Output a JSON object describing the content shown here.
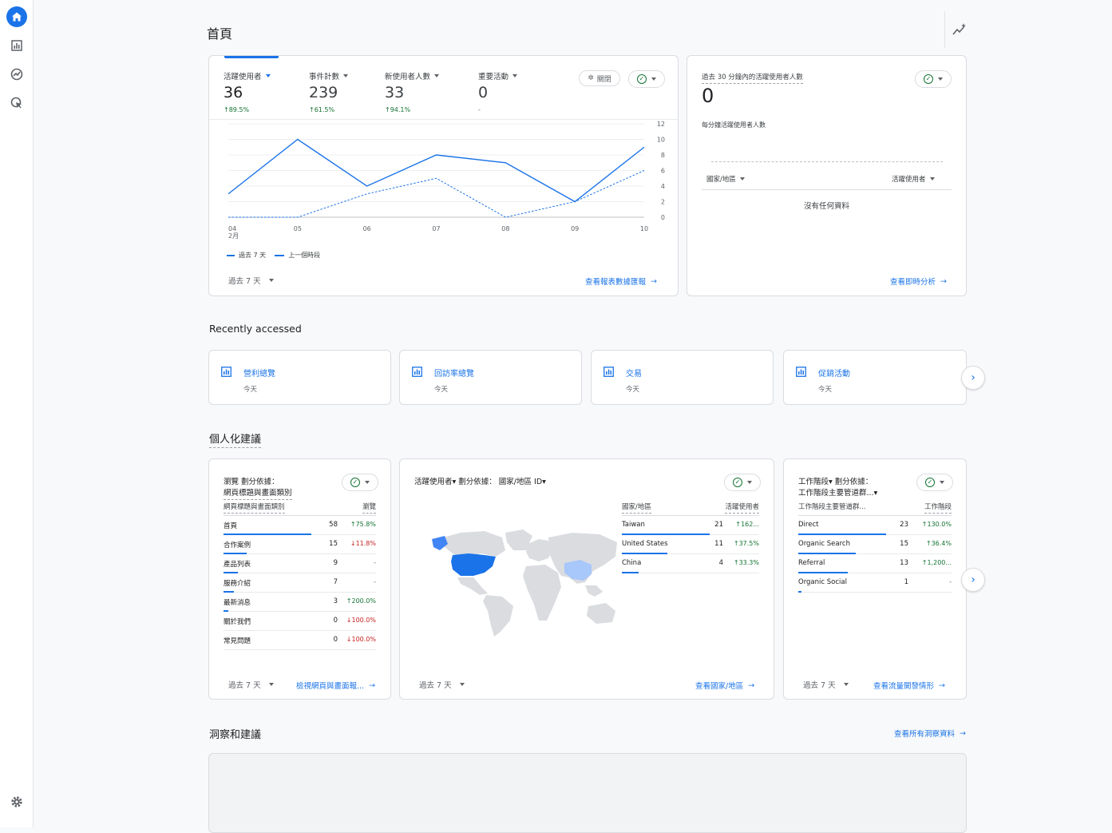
{
  "page": {
    "title": "首頁"
  },
  "rail": {
    "icons": [
      "home-icon",
      "reports-icon",
      "explore-icon",
      "advertising-icon",
      "settings-icon"
    ]
  },
  "overview": {
    "metrics": [
      {
        "label": "活躍使用者",
        "value": "36",
        "change": "↑89.5%"
      },
      {
        "label": "事件計數",
        "value": "239",
        "change": "↑61.5%"
      },
      {
        "label": "新使用者人數",
        "value": "33",
        "change": "↑94.1%"
      },
      {
        "label": "重要活動",
        "value": "0",
        "change": "-"
      }
    ],
    "insight_pill": "關閉",
    "legend": {
      "current": "過去 7 天",
      "previous": "上一個時段"
    },
    "date_range": "過去 7 天",
    "link": "查看報表數據匯報",
    "month_label": "2月"
  },
  "chart_data": {
    "type": "line",
    "categories": [
      "04",
      "05",
      "06",
      "07",
      "08",
      "09",
      "10"
    ],
    "series": [
      {
        "name": "過去 7 天",
        "values": [
          3,
          10,
          4,
          8,
          7,
          2,
          9
        ]
      },
      {
        "name": "上一個時段",
        "values": [
          0,
          0,
          3,
          5,
          0,
          2,
          6
        ]
      }
    ],
    "y_ticks": [
      "12",
      "10",
      "8",
      "6",
      "4",
      "2",
      "0"
    ],
    "ylim": [
      0,
      12
    ],
    "grid": true,
    "legend_position": "bottom-left"
  },
  "realtime": {
    "title": "過去 30 分鐘內的活躍使用者人數",
    "value": "0",
    "subtitle": "每分鐘活躍使用者人數",
    "col1": "國家/地區",
    "col2": "活躍使用者",
    "empty": "沒有任何資料",
    "link": "查看即時分析"
  },
  "recent": {
    "title": "Recently accessed",
    "items": [
      {
        "label": "營利總覽",
        "sub": "今天"
      },
      {
        "label": "回訪率總覽",
        "sub": "今天"
      },
      {
        "label": "交易",
        "sub": "今天"
      },
      {
        "label": "促銷活動",
        "sub": "今天"
      }
    ]
  },
  "personal": {
    "title": "個人化建議",
    "cards": [
      {
        "title_a": "瀏覽 劃分依據：",
        "title_b": "網頁標題與畫面類別",
        "col1": "網頁標題與畫面類別",
        "col2": "瀏覽",
        "rows": [
          {
            "name": "首頁",
            "value": "58",
            "change": "↑75.8%",
            "dir": "up",
            "bar": 1.0
          },
          {
            "name": "合作案例",
            "value": "15",
            "change": "↓11.8%",
            "dir": "dn",
            "bar": 0.26
          },
          {
            "name": "產品列表",
            "value": "9",
            "change": "-",
            "dir": "gr",
            "bar": 0.16
          },
          {
            "name": "服務介紹",
            "value": "7",
            "change": "-",
            "dir": "gr",
            "bar": 0.12
          },
          {
            "name": "最新消息",
            "value": "3",
            "change": "↑200.0%",
            "dir": "up",
            "bar": 0.05
          },
          {
            "name": "關於我們",
            "value": "0",
            "change": "↓100.0%",
            "dir": "dn",
            "bar": 0
          },
          {
            "name": "常見問題",
            "value": "0",
            "change": "↓100.0%",
            "dir": "dn",
            "bar": 0
          }
        ],
        "date": "過去 7 天",
        "link": "檢視網頁與畫面報..."
      },
      {
        "title_a": "活躍使用者▾ 劃分依據： 國家/地區 ID▾",
        "col1": "國家/地區",
        "col2": "活躍使用者",
        "rows": [
          {
            "name": "Taiwan",
            "value": "21",
            "change": "↑162...",
            "dir": "up",
            "bar": 1.0
          },
          {
            "name": "United States",
            "value": "11",
            "change": "↑37.5%",
            "dir": "up",
            "bar": 0.52
          },
          {
            "name": "China",
            "value": "4",
            "change": "↑33.3%",
            "dir": "up",
            "bar": 0.19
          }
        ],
        "date": "過去 7 天",
        "link": "查看國家/地區"
      },
      {
        "title_a": "工作階段▾ 劃分依據：",
        "title_b": "工作階段主要管道群...▾",
        "col1": "工作階段主要管道群...",
        "col2": "工作階段",
        "rows": [
          {
            "name": "Direct",
            "value": "23",
            "change": "↑130.0%",
            "dir": "up",
            "bar": 1.0
          },
          {
            "name": "Organic Search",
            "value": "15",
            "change": "↑36.4%",
            "dir": "up",
            "bar": 0.65
          },
          {
            "name": "Referral",
            "value": "13",
            "change": "↑1,200...",
            "dir": "up",
            "bar": 0.56
          },
          {
            "name": "Organic Social",
            "value": "1",
            "change": "-",
            "dir": "gr",
            "bar": 0.04
          }
        ],
        "date": "過去 7 天",
        "link": "查看流量開發情形"
      }
    ]
  },
  "insights": {
    "title": "洞察和建議",
    "link": "查看所有洞察資料"
  }
}
